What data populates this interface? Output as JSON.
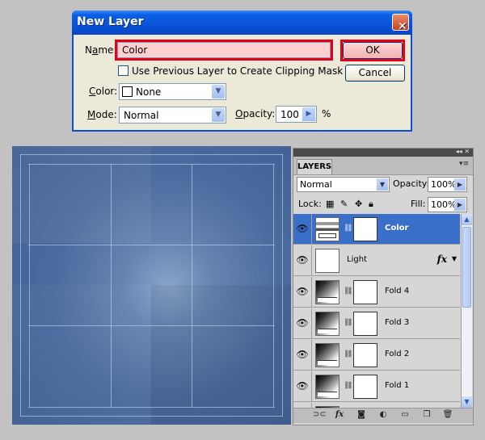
{
  "dialog": {
    "title": "New Layer",
    "close_glyph": "✕",
    "name_label_prefix": "N",
    "name_label_accel": "a",
    "name_label_rest": "me:",
    "name_value": "Color",
    "ok_label": "OK",
    "cancel_label": "Cancel",
    "clip_label": "Use Previous Layer to Create Clipping Mask",
    "clip_checked": false,
    "color_label_accel": "C",
    "color_label_rest": "olor:",
    "color_value": "None",
    "mode_label_accel": "M",
    "mode_label_rest": "ode:",
    "mode_value": "Normal",
    "opacity_label_accel": "O",
    "opacity_label_rest": "pacity:",
    "opacity_value": "100",
    "opacity_unit": "%"
  },
  "layers_panel": {
    "tab_label": "LAYERS",
    "blend_mode": "Normal",
    "opacity_label": "Opacity:",
    "opacity_value": "100%",
    "lock_label": "Lock:",
    "fill_label": "Fill:",
    "fill_value": "100%",
    "layers": [
      {
        "name": "Color",
        "selected": true,
        "type": "adjustment",
        "has_mask": true,
        "fx": false
      },
      {
        "name": "Light",
        "selected": false,
        "type": "plain",
        "has_mask": false,
        "fx": true
      },
      {
        "name": "Fold 4",
        "selected": false,
        "type": "gradient",
        "has_mask": true,
        "fx": false
      },
      {
        "name": "Fold 3",
        "selected": false,
        "type": "gradient",
        "has_mask": true,
        "fx": false
      },
      {
        "name": "Fold 2",
        "selected": false,
        "type": "gradient",
        "has_mask": true,
        "fx": false
      },
      {
        "name": "Fold 1",
        "selected": false,
        "type": "gradient",
        "has_mask": true,
        "fx": false
      }
    ],
    "fx_label": "fx",
    "bottom_icons": [
      "link-icon",
      "fx-icon",
      "mask-icon",
      "adjustment-icon",
      "folder-icon",
      "new-layer-icon",
      "trash-icon"
    ]
  },
  "colors": {
    "selection_blue": "#3a6fc9",
    "highlight_red": "#e3001b",
    "canvas_blue": "#4a6b9e"
  }
}
